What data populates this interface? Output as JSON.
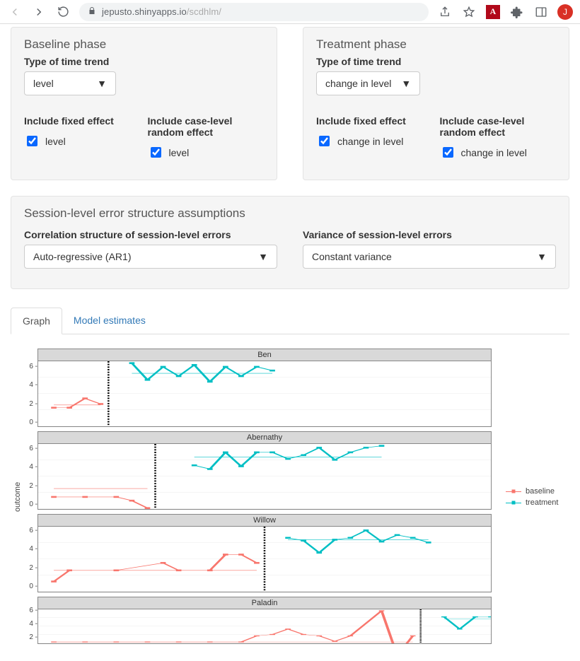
{
  "browser": {
    "host": "jepusto.shinyapps.io",
    "path": "/scdhlm/",
    "avatar_initial": "J"
  },
  "baseline_panel": {
    "title": "Baseline phase",
    "trend_label": "Type of time trend",
    "trend_value": "level",
    "fixed_label": "Include fixed effect",
    "fixed_cb": "level",
    "rand_label": "Include case-level random effect",
    "rand_cb": "level"
  },
  "treatment_panel": {
    "title": "Treatment phase",
    "trend_label": "Type of time trend",
    "trend_value": "change in level",
    "fixed_label": "Include fixed effect",
    "fixed_cb": "change in level",
    "rand_label": "Include case-level random effect",
    "rand_cb": "change in level"
  },
  "error_panel": {
    "title": "Session-level error structure assumptions",
    "corr_label": "Correlation structure of session-level errors",
    "corr_value": "Auto-regressive (AR1)",
    "var_label": "Variance of session-level errors",
    "var_value": "Constant variance"
  },
  "tabs": {
    "graph": "Graph",
    "estimates": "Model estimates"
  },
  "legend": {
    "baseline": "baseline",
    "treatment": "treatment"
  },
  "axis": {
    "y_label": "outcome"
  },
  "chart_data": {
    "type": "line",
    "ylabel": "outcome",
    "ylim": [
      0,
      7
    ],
    "y_ticks": [
      0,
      2,
      4,
      6
    ],
    "xlim": [
      1,
      30
    ],
    "facets": [
      {
        "name": "Ben",
        "phase_boundary": 5.5,
        "series": [
          {
            "name": "baseline",
            "color": "#f8766d",
            "x": [
              2,
              3,
              4,
              5
            ],
            "y": [
              2,
              2,
              3,
              2.4
            ],
            "fit": 2.3
          },
          {
            "name": "treatment",
            "color": "#00bfc4",
            "x": [
              7,
              8,
              9,
              10,
              11,
              12,
              13,
              14,
              15,
              16
            ],
            "y": [
              6.8,
              5,
              6.4,
              5.4,
              6.6,
              4.8,
              6.4,
              5.4,
              6.4,
              6
            ],
            "fit": 5.7
          }
        ]
      },
      {
        "name": "Abernathy",
        "phase_boundary": 8.5,
        "series": [
          {
            "name": "baseline",
            "color": "#f8766d",
            "x": [
              2,
              4,
              6,
              7,
              8
            ],
            "y": [
              1.3,
              1.3,
              1.3,
              0.9,
              0.1
            ],
            "fit": 2.2
          },
          {
            "name": "treatment",
            "color": "#00bfc4",
            "x": [
              11,
              12,
              13,
              14,
              15,
              16,
              17,
              18,
              19,
              20,
              21,
              22,
              23
            ],
            "y": [
              4.7,
              4.3,
              6.1,
              4.6,
              6.1,
              6.1,
              5.4,
              5.8,
              6.6,
              5.3,
              6.1,
              6.6,
              6.8
            ],
            "fit": 5.6
          }
        ]
      },
      {
        "name": "Willow",
        "phase_boundary": 15.5,
        "series": [
          {
            "name": "baseline",
            "color": "#f8766d",
            "x": [
              2,
              3,
              6,
              9,
              10,
              12,
              13,
              14,
              15
            ],
            "y": [
              1.1,
              2.3,
              2.3,
              3.1,
              2.3,
              2.3,
              4.0,
              4.0,
              3.1
            ],
            "fit": 2.3
          },
          {
            "name": "treatment",
            "color": "#00bfc4",
            "x": [
              17,
              18,
              19,
              20,
              21,
              22,
              23,
              24,
              25,
              26
            ],
            "y": [
              5.8,
              5.5,
              4.2,
              5.6,
              5.8,
              6.6,
              5.4,
              6.1,
              5.8,
              5.3
            ],
            "fit": 5.6
          }
        ]
      },
      {
        "name": "Paladin",
        "phase_boundary": 25.5,
        "series": [
          {
            "name": "baseline",
            "color": "#f8766d",
            "x": [
              2,
              4,
              6,
              8,
              10,
              12,
              14,
              15,
              16,
              17,
              18,
              19,
              20,
              21,
              23,
              24,
              25
            ],
            "y": [
              2.2,
              2.2,
              2.2,
              2.2,
              2.2,
              2.2,
              2.2,
              3.1,
              3.3,
              4.1,
              3.3,
              3.1,
              2.3,
              3.1,
              6.8,
              0.2,
              3.1
            ],
            "fit": 2.2
          },
          {
            "name": "treatment",
            "color": "#00bfc4",
            "x": [
              27,
              28,
              29,
              30
            ],
            "y": [
              5.9,
              4.1,
              5.9,
              5.9
            ],
            "fit": 5.6
          }
        ]
      }
    ]
  }
}
